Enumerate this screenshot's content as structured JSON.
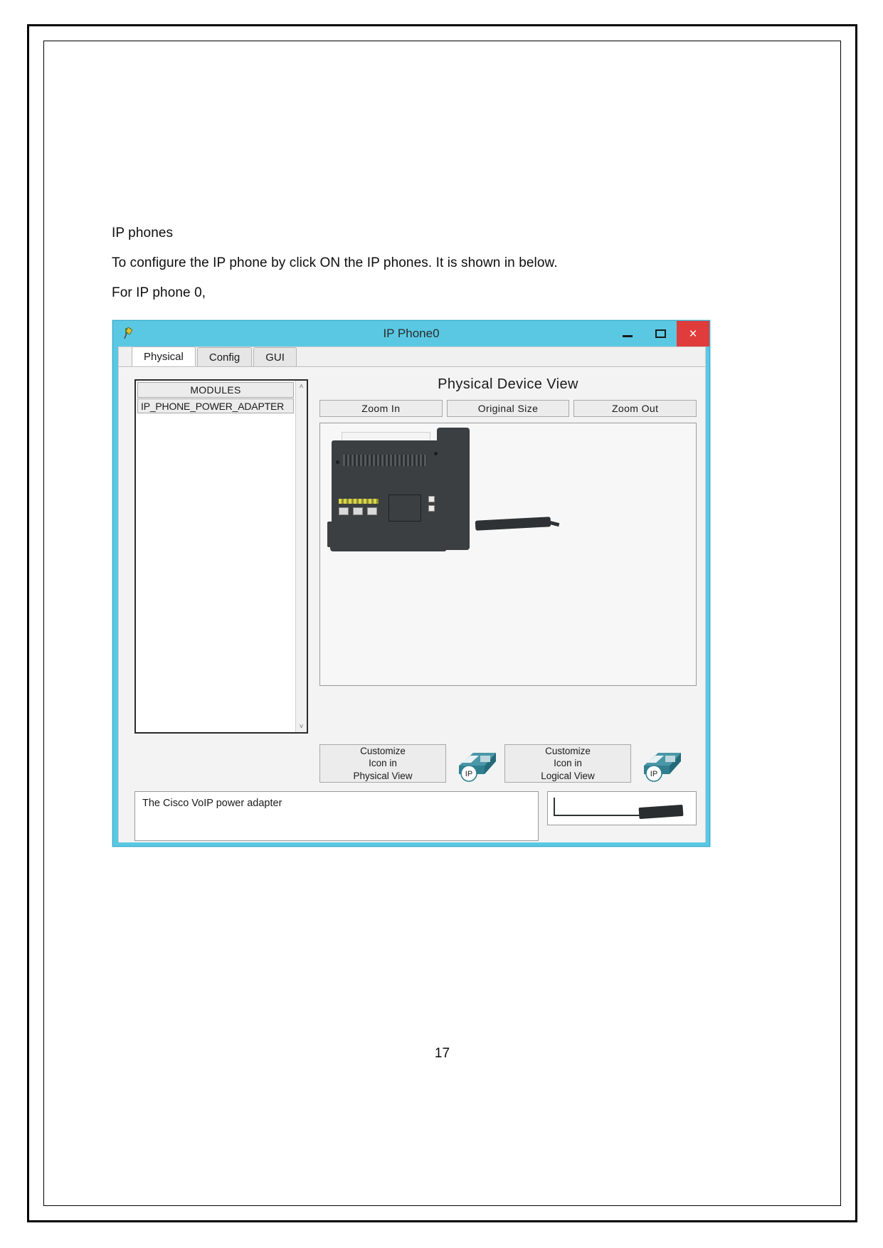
{
  "document": {
    "heading": "IP phones",
    "body": "To configure the IP phone by click ON the IP phones. It is shown in below.",
    "subheading": "For IP phone 0,",
    "page_number": "17"
  },
  "window": {
    "title": "IP Phone0",
    "icon": "packet-tracer-icon",
    "controls": {
      "minimize": "minimize-icon",
      "maximize": "maximize-icon",
      "close": "×"
    },
    "tabs": [
      {
        "label": "Physical",
        "active": true
      },
      {
        "label": "Config",
        "active": false
      },
      {
        "label": "GUI",
        "active": false
      }
    ],
    "modules": {
      "header": "MODULES",
      "items": [
        "IP_PHONE_POWER_ADAPTER"
      ],
      "scroll_up": "˄",
      "scroll_down": "˅"
    },
    "device_view": {
      "title": "Physical Device View",
      "zoom_buttons": [
        "Zoom In",
        "Original Size",
        "Zoom Out"
      ]
    },
    "customize": {
      "physical_label_line1": "Customize",
      "physical_label_line2": "Icon in",
      "physical_label_line3": "Physical View",
      "logical_label_line1": "Customize",
      "logical_label_line2": "Icon in",
      "logical_label_line3": "Logical View",
      "icon_badge": "IP"
    },
    "description": "The Cisco VoIP power adapter"
  },
  "colors": {
    "titlebar": "#5bc8e3",
    "close_button": "#e03c3c",
    "phone_icon": "#2f7f90"
  }
}
